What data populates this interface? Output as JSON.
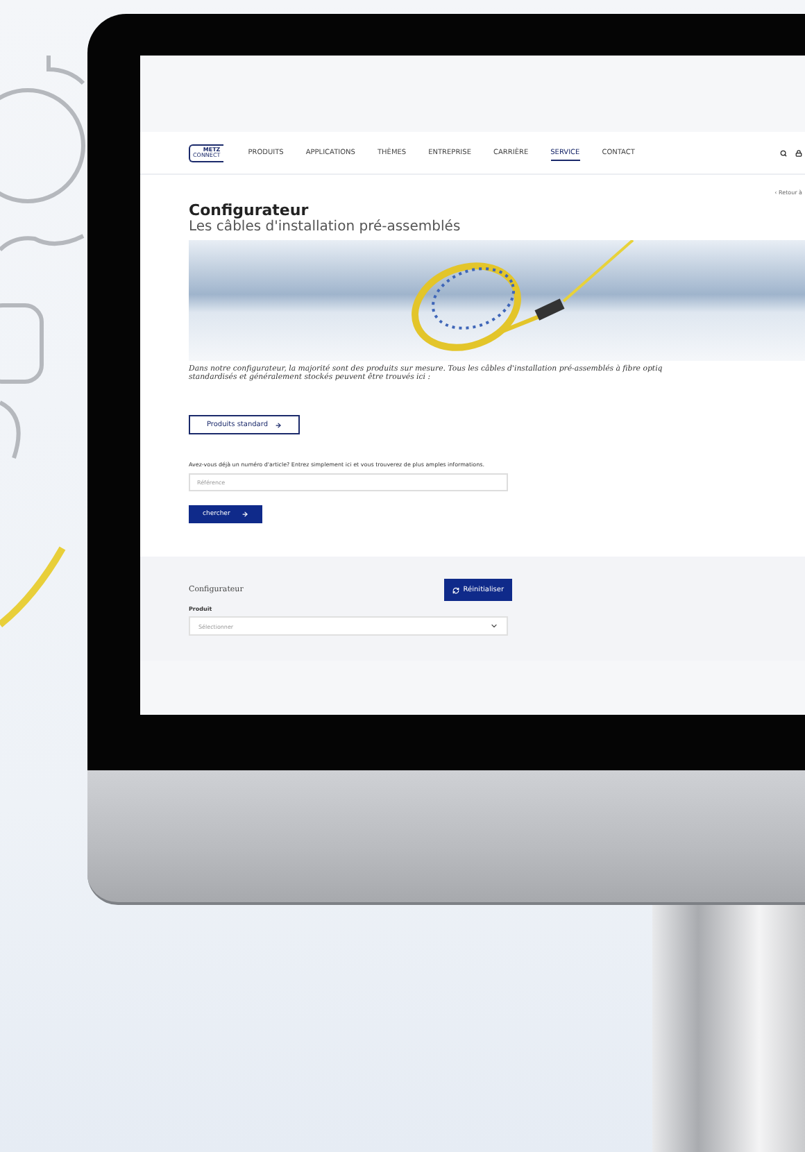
{
  "logo": {
    "line1": "METZ",
    "line2": "CONNECT"
  },
  "nav": [
    {
      "label": "PRODUITS",
      "selected": false
    },
    {
      "label": "APPLICATIONS",
      "selected": false
    },
    {
      "label": "THÈMES",
      "selected": false
    },
    {
      "label": "ENTREPRISE",
      "selected": false
    },
    {
      "label": "CARRIÈRE",
      "selected": false
    },
    {
      "label": "SERVICE",
      "selected": true
    },
    {
      "label": "CONTACT",
      "selected": false
    }
  ],
  "back_link": "‹ Retour à",
  "title": "Configurateur",
  "subtitle": "Les câbles d'installation pré-assemblés",
  "description_lines": [
    "Dans notre configurateur, la majorité sont des produits sur mesure. Tous les câbles d'installation pré-assemblés à fibre optiq",
    "standardisés et généralement stockés peuvent être trouvés ici :"
  ],
  "standard_button": "Produits standard",
  "article_prompt": "Avez-vous déjà un numéro d'article? Entrez simplement ici et vous trouverez de plus amples informations.",
  "reference_field": {
    "placeholder": "Référence"
  },
  "search_button": "chercher",
  "configurator": {
    "heading": "Configurateur",
    "reset_button": "Réinitialiser",
    "product_label": "Produit",
    "product_select": {
      "placeholder": "Sélectionner"
    }
  }
}
